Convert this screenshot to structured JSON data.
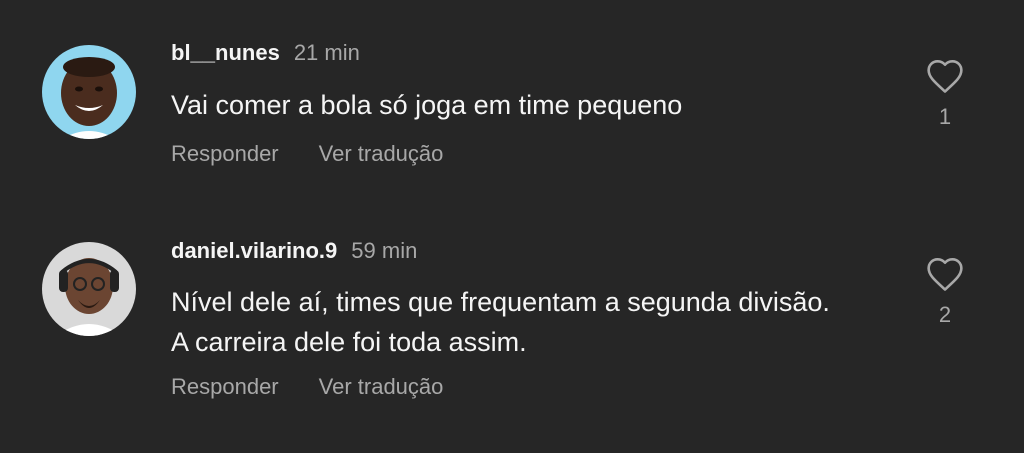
{
  "comments": [
    {
      "username": "bl__nunes",
      "time": "21 min",
      "text": "Vai comer a bola só joga em time pequeno",
      "reply_label": "Responder",
      "translate_label": "Ver tradução",
      "likes": "1",
      "like_icon": "heart-outline-icon"
    },
    {
      "username": "daniel.vilarino.9",
      "time": "59 min",
      "text": "Nível dele aí, times que frequentam a segunda divisão. A carreira dele foi toda assim.",
      "reply_label": "Responder",
      "translate_label": "Ver tradução",
      "likes": "2",
      "like_icon": "heart-outline-icon"
    }
  ]
}
